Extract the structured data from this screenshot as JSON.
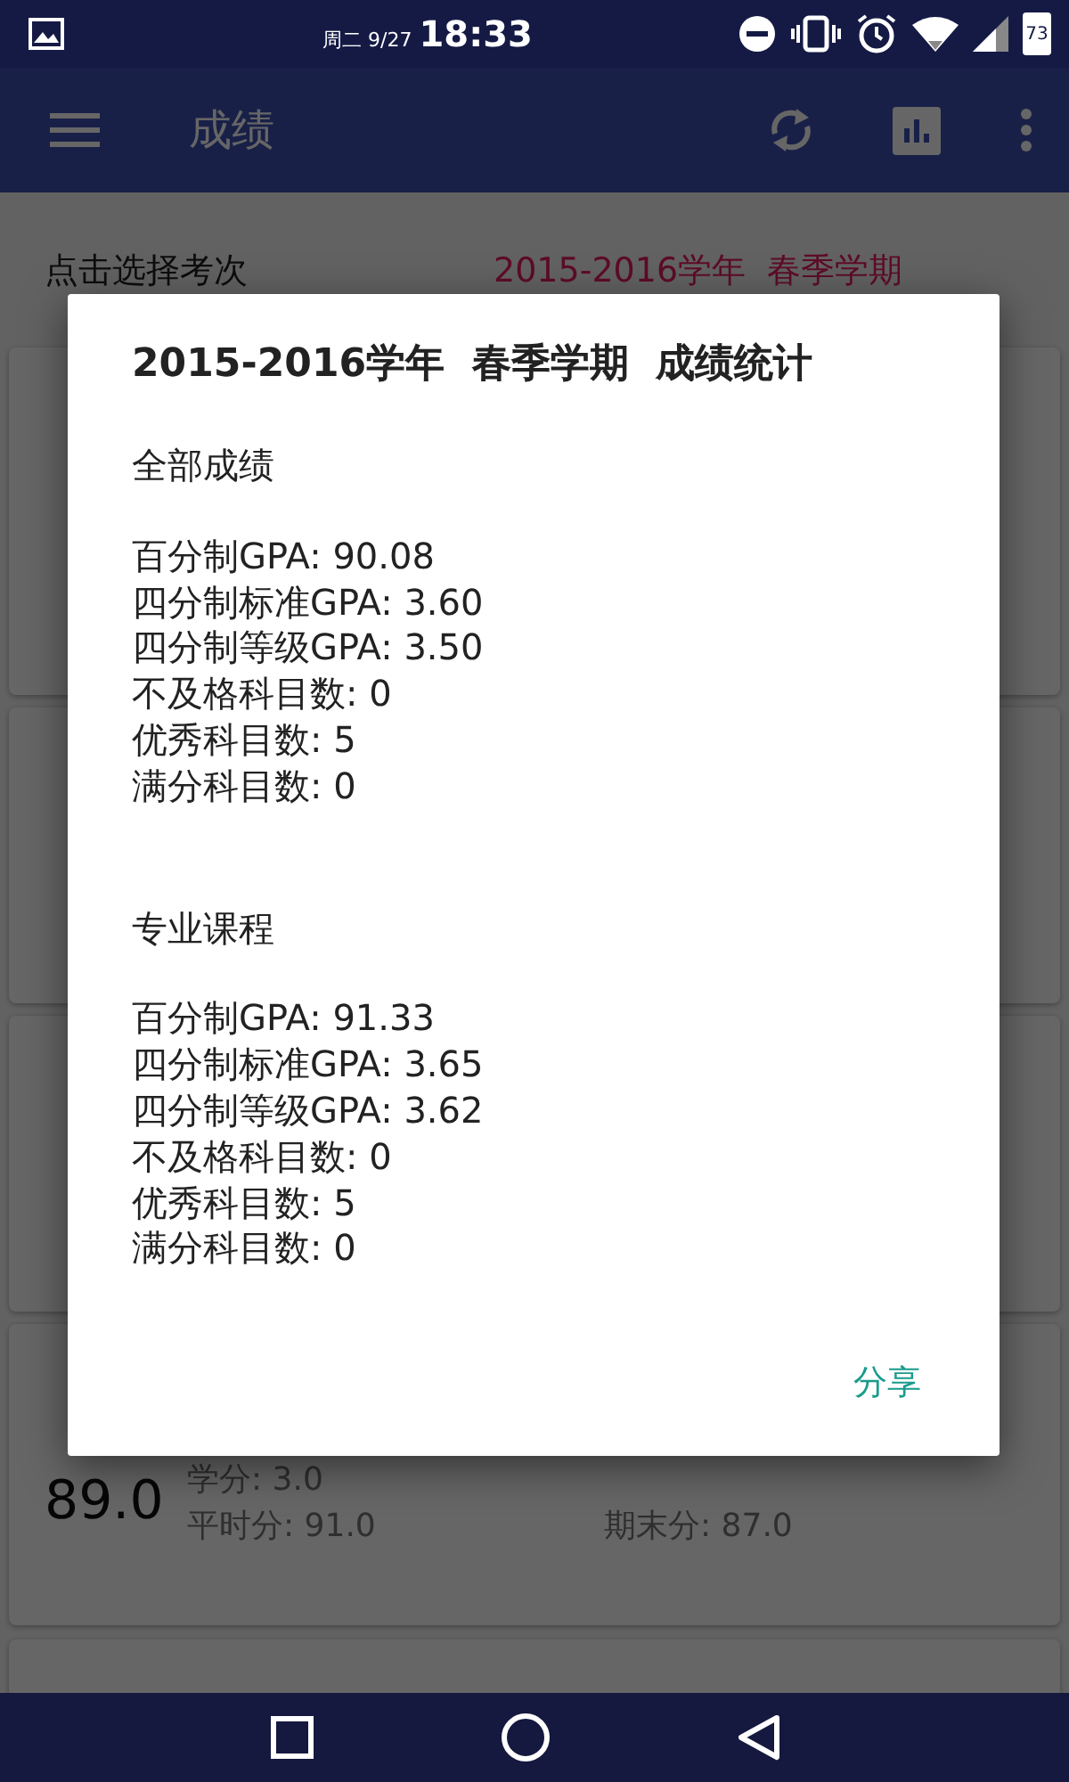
{
  "status_bar": {
    "date": "周二 9/27",
    "time": "18:33",
    "battery": "73"
  },
  "toolbar": {
    "title": "成绩"
  },
  "exam_selector": {
    "label": "点击选择考次",
    "value": "2015-2016学年  春季学期"
  },
  "cards": [
    {
      "score": "89.0",
      "lines": [
        {
          "texts": [
            "学分: 3.0"
          ]
        },
        {
          "texts": [
            "平时分: 91.0",
            "期末分: 87.0"
          ]
        }
      ]
    }
  ],
  "dialog": {
    "title": "2015-2016学年  春季学期  成绩统计",
    "sections": [
      {
        "heading": "全部成绩",
        "lines": [
          "百分制GPA: 90.08",
          "四分制标准GPA: 3.60",
          "四分制等级GPA: 3.50",
          "不及格科目数: 0",
          "优秀科目数: 5",
          "满分科目数: 0"
        ]
      },
      {
        "heading": "专业课程",
        "lines": [
          "百分制GPA: 91.33",
          "四分制标准GPA: 3.65",
          "四分制等级GPA: 3.62",
          "不及格科目数: 0",
          "优秀科目数: 5",
          "满分科目数: 0"
        ]
      }
    ],
    "button": "分享"
  }
}
